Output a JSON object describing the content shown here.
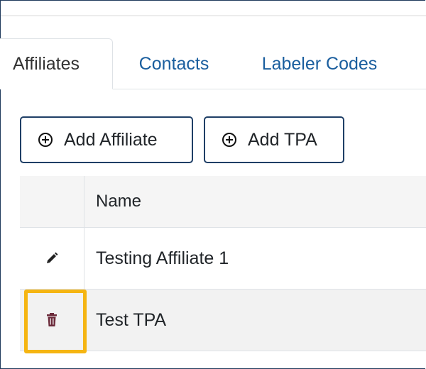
{
  "tabs": [
    {
      "label": "Affiliates",
      "active": true
    },
    {
      "label": "Contacts",
      "active": false
    },
    {
      "label": "Labeler Codes",
      "active": false
    }
  ],
  "toolbar": {
    "add_affiliate_label": "Add Affiliate",
    "add_tpa_label": "Add TPA",
    "button_icon": "plus-circle-icon"
  },
  "table": {
    "columns": [
      "",
      "Name"
    ],
    "rows": [
      {
        "name": "Testing Affiliate 1",
        "action_icon": "pencil-icon"
      },
      {
        "name": "Test TPA",
        "action_icon": "trash-icon"
      }
    ]
  },
  "colors": {
    "tab_link": "#1a5e9e",
    "button_border": "#1f3f66",
    "highlight": "#f5b512",
    "trash_icon": "#6b2a3a"
  }
}
